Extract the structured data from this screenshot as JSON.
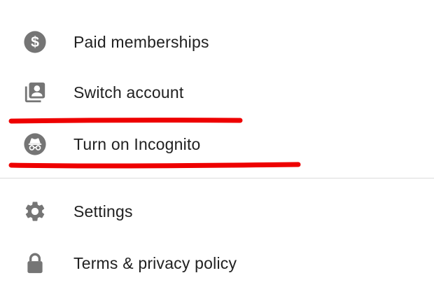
{
  "menu": {
    "items": [
      {
        "label": "Paid memberships",
        "icon": "dollar-circle-icon"
      },
      {
        "label": "Switch account",
        "icon": "switch-account-icon"
      },
      {
        "label": "Turn on Incognito",
        "icon": "incognito-icon"
      },
      {
        "label": "Settings",
        "icon": "gear-icon"
      },
      {
        "label": "Terms & privacy policy",
        "icon": "lock-icon"
      }
    ]
  },
  "colors": {
    "icon": "#757575",
    "text": "#212121",
    "annotation": "#ee0000",
    "divider": "#dcdcdc"
  }
}
